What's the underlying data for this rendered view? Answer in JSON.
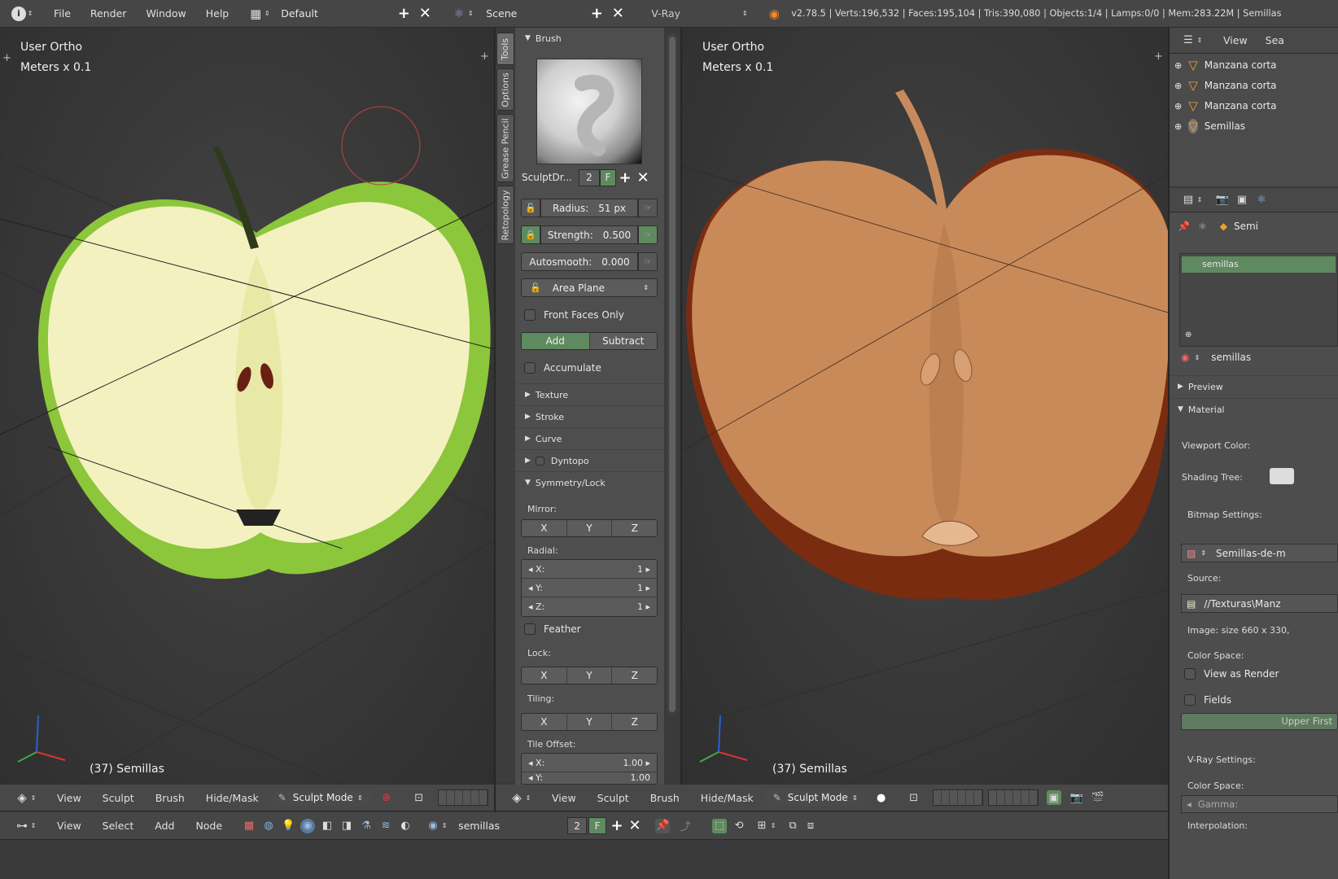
{
  "topbar": {
    "menus": [
      "File",
      "Render",
      "Window",
      "Help"
    ],
    "screen_layout": "Default",
    "scene": "Scene",
    "render_engine": "V-Ray",
    "stats": "v2.78.5 | Verts:196,532 | Faces:195,104 | Tris:390,080 | Objects:1/4 | Lamps:0/0 | Mem:283.22M | Semillas"
  },
  "viewport_left": {
    "view": "User Ortho",
    "units": "Meters x 0.1",
    "object": "(37) Semillas"
  },
  "viewport_right": {
    "view": "User Ortho",
    "units": "Meters x 0.1",
    "object": "(37) Semillas"
  },
  "tabs": [
    "Tools",
    "Options",
    "Grease Pencil",
    "Retopology"
  ],
  "tool_panel": {
    "brush_header": "Brush",
    "brush_name": "SculptDr...",
    "brush_users": "2",
    "brush_fake": "F",
    "radius_label": "Radius:",
    "radius_value": "51 px",
    "strength_label": "Strength:",
    "strength_value": "0.500",
    "autosmooth_label": "Autosmooth:",
    "autosmooth_value": "0.000",
    "area_plane": "Area Plane",
    "front_faces": "Front Faces Only",
    "add": "Add",
    "subtract": "Subtract",
    "accumulate": "Accumulate",
    "sections": [
      "Texture",
      "Stroke",
      "Curve",
      "Dyntopo"
    ],
    "symmetry": "Symmetry/Lock",
    "mirror_label": "Mirror:",
    "x": "X",
    "y": "Y",
    "z": "Z",
    "radial_label": "Radial:",
    "radial": [
      {
        "axis": "X:",
        "value": "1"
      },
      {
        "axis": "Y:",
        "value": "1"
      },
      {
        "axis": "Z:",
        "value": "1"
      }
    ],
    "feather": "Feather",
    "lock_label": "Lock:",
    "tiling_label": "Tiling:",
    "tile_offset_label": "Tile Offset:",
    "tile_offset": [
      {
        "axis": "X:",
        "value": "1.00"
      },
      {
        "axis": "Y:",
        "value": "1.00"
      }
    ]
  },
  "viewport_header_left": {
    "menus": [
      "View",
      "Sculpt",
      "Brush",
      "Hide/Mask"
    ],
    "mode": "Sculpt Mode"
  },
  "viewport_header_right": {
    "menus": [
      "View",
      "Sculpt",
      "Brush",
      "Hide/Mask"
    ],
    "mode": "Sculpt Mode"
  },
  "node_header": {
    "menus": [
      "View",
      "Select",
      "Add",
      "Node"
    ],
    "material": "semillas",
    "users": "2",
    "fake": "F"
  },
  "outliner": {
    "view": "View",
    "search": "Sea",
    "items": [
      "Manzana corta",
      "Manzana corta",
      "Manzana corta",
      "Semillas"
    ]
  },
  "properties": {
    "object": "Semi",
    "slot": "semillas",
    "material": "semillas",
    "preview": "Preview",
    "material_section": "Material",
    "viewport_color": "Viewport Color:",
    "shading_tree": "Shading Tree:",
    "bitmap_settings": "Bitmap Settings:",
    "bitmap_name": "Semillas-de-m",
    "source": "Source:",
    "path": "//Texturas\\Manz",
    "image_size": "Image: size 660 x 330,",
    "color_space": "Color Space:",
    "view_as_render": "View as Render",
    "fields": "Fields",
    "upper_first": "Upper First",
    "vray_settings": "V-Ray Settings:",
    "color_space2": "Color Space:",
    "gamma": "Gamma:",
    "interpolation": "Interpolation:"
  }
}
